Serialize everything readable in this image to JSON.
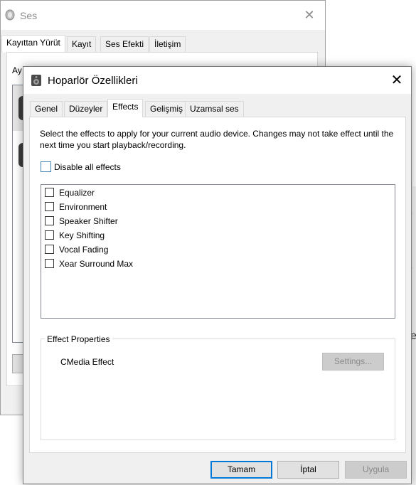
{
  "background_window": {
    "title": "Ses",
    "tabs": [
      "Kayıttan Yürüt",
      "Kayıt",
      "Ses Efekti",
      "İletişim"
    ],
    "partial_text": "Ay",
    "edge_text": "e"
  },
  "dialog": {
    "title": "Hoparlör Özellikleri",
    "tabs": [
      "Genel",
      "Düzeyler",
      "Effects",
      "Gelişmiş",
      "Uzamsal ses"
    ],
    "active_tab": "Effects",
    "description": "Select the effects to apply for your current audio device. Changes may not take effect until the next time you start playback/recording.",
    "disable_all": {
      "label": "Disable all effects",
      "checked": false
    },
    "effects": [
      {
        "label": "Equalizer",
        "checked": false
      },
      {
        "label": "Environment",
        "checked": false
      },
      {
        "label": "Speaker Shifter",
        "checked": false
      },
      {
        "label": "Key Shifting",
        "checked": false
      },
      {
        "label": "Vocal Fading",
        "checked": false
      },
      {
        "label": "Xear Surround Max",
        "checked": false
      }
    ],
    "effect_properties": {
      "group_label": "Effect Properties",
      "name": "CMedia Effect",
      "settings_label": "Settings..."
    },
    "buttons": {
      "ok": "Tamam",
      "cancel": "İptal",
      "apply": "Uygula"
    }
  }
}
